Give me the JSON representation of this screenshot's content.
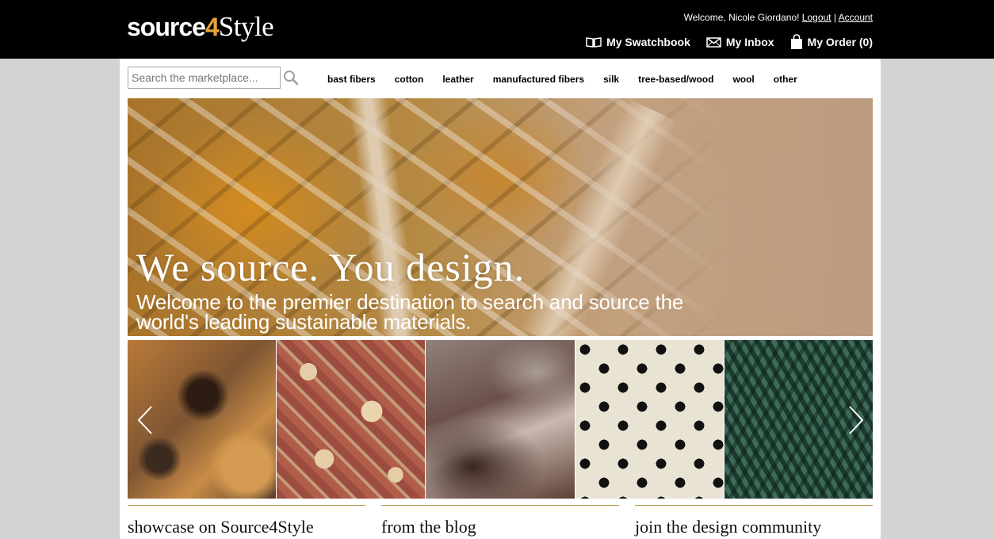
{
  "header": {
    "logo": {
      "part1": "source",
      "part2": "4",
      "part3": "Style"
    },
    "welcome_text": "Welcome, Nicole Giordano!",
    "logout_label": "Logout",
    "separator": "|",
    "account_label": "Account",
    "swatchbook_label": "My Swatchbook",
    "inbox_label": "My Inbox",
    "order_label": "My Order (0)",
    "icons": [
      "swatchbook-icon",
      "envelope-icon",
      "shopping-bag-icon"
    ]
  },
  "search": {
    "placeholder": "Search the marketplace..."
  },
  "categories": [
    "bast fibers",
    "cotton",
    "leather",
    "manufactured fibers",
    "silk",
    "tree-based/wood",
    "wool",
    "other"
  ],
  "hero": {
    "title": "We source. You design.",
    "subtitle": "Welcome to the premier destination to search and source the world's leading sustainable materials."
  },
  "sections": [
    "showcase on Source4Style",
    "from the blog",
    "join the design community"
  ],
  "colors": {
    "topbar": "#000000",
    "accent": "#e8a33a",
    "section_rule": "#b8913f",
    "page_bg": "#d3d3d3"
  }
}
